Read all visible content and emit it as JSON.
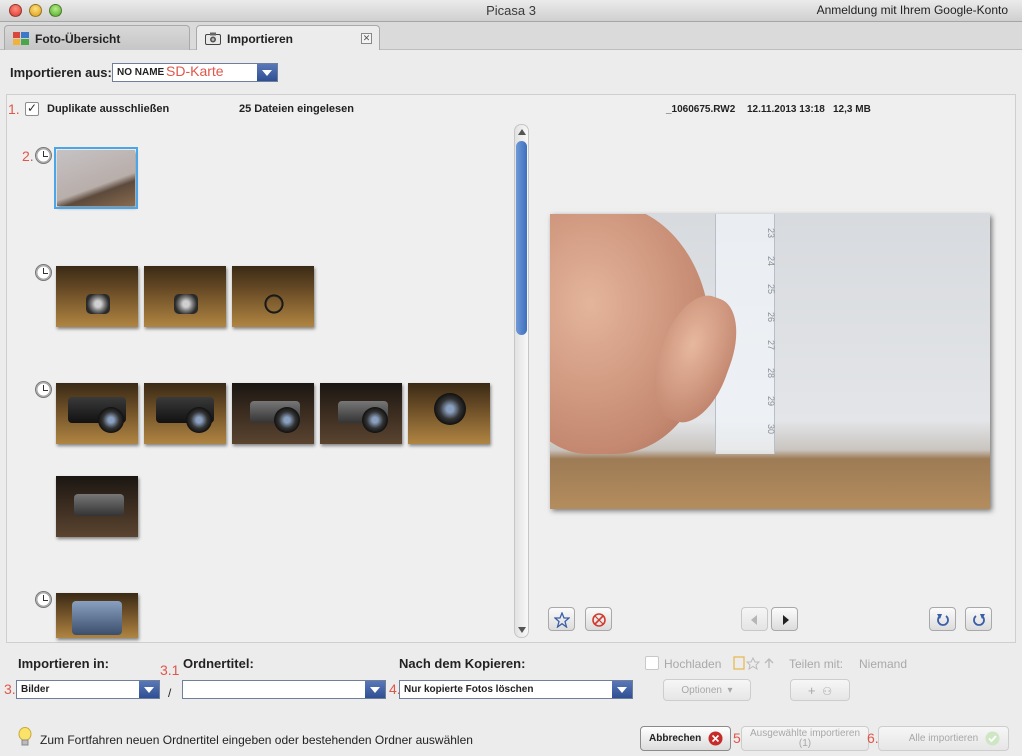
{
  "window": {
    "title": "Picasa 3",
    "signin": "Anmeldung mit Ihrem Google-Konto"
  },
  "tabs": [
    {
      "label": "Foto-Übersicht",
      "icon": "grid-icon",
      "active": false
    },
    {
      "label": "Importieren",
      "icon": "camera-icon",
      "active": true,
      "close": "✕"
    }
  ],
  "source": {
    "label": "Importieren aus:",
    "value": "NO NAME",
    "annotation": "SD-Karte"
  },
  "options": {
    "exclude_duplicates": {
      "label": "Duplikate ausschließen",
      "checked": true
    },
    "files_read": "25 Dateien eingelesen"
  },
  "preview_meta": {
    "filename": "_1060675.RW2",
    "date": "12.11.2013 13:18",
    "size": "12,3 MB"
  },
  "ruler_numbers": [
    "23",
    "24",
    "25",
    "26",
    "27",
    "28",
    "29",
    "30"
  ],
  "annotations": {
    "n1": "1.",
    "n2": "2.",
    "n3": "3.",
    "n31": "3.1",
    "n4": "4.",
    "n5": "5.",
    "n6": "6."
  },
  "bottom": {
    "import_in_label": "Importieren in:",
    "import_in_value": "Bilder",
    "folder_title_label": "Ordnertitel:",
    "folder_title_value": "",
    "separator": "/",
    "after_copy_label": "Nach dem Kopieren:",
    "after_copy_value": "Nur kopierte Fotos löschen",
    "upload_label": "Hochladen",
    "share_label": "Teilen mit:",
    "share_value": "Niemand",
    "options_btn": "Optionen",
    "add_btn": "+",
    "hint": "Zum Fortfahren neuen Ordnertitel eingeben oder bestehenden Ordner auswählen",
    "cancel_btn": "Abbrechen",
    "import_selected_btn": "Ausgewählte importieren",
    "import_selected_count": "(1)",
    "import_all_btn": "Alle importieren"
  },
  "colors": {
    "annotation": "#e0564a",
    "accent_blue": "#3d6fbf",
    "cancel_red": "#c62a2a",
    "ok_green": "#9ccc8a"
  }
}
